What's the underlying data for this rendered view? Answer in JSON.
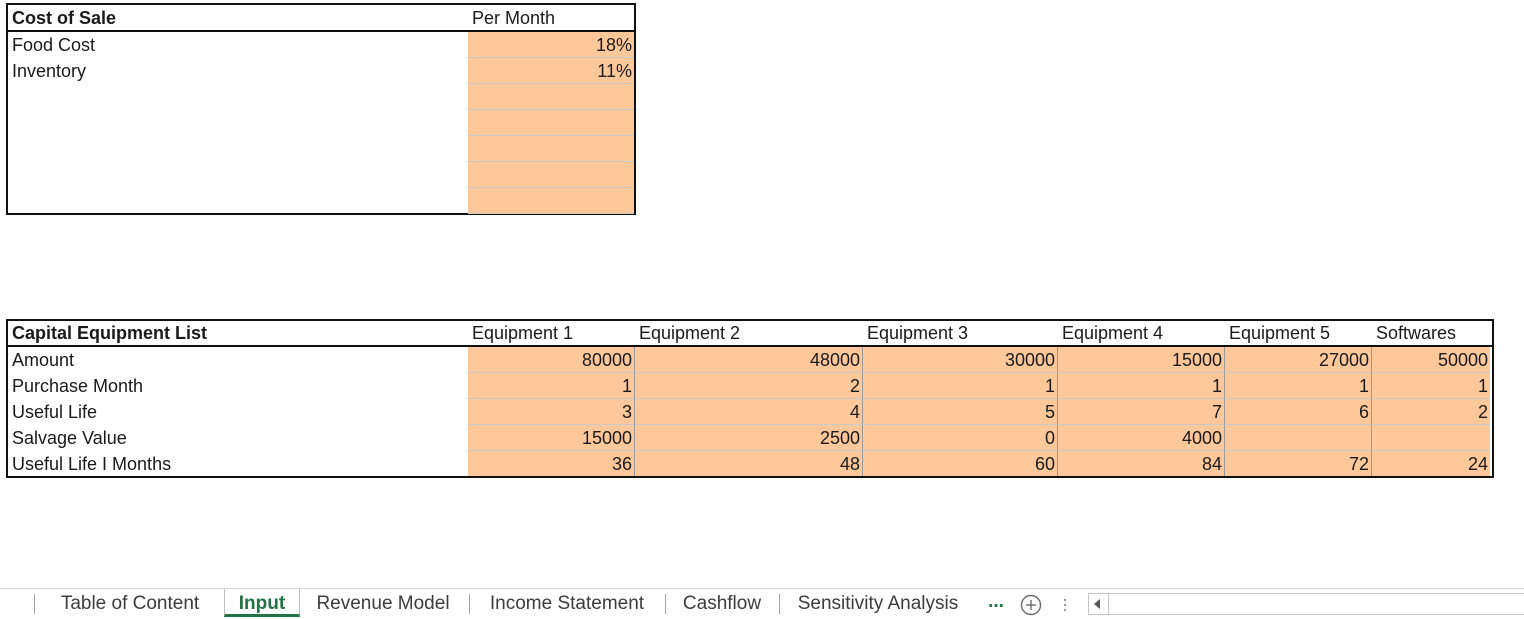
{
  "cost_of_sale": {
    "title": "Cost of Sale",
    "column_header": "Per Month",
    "rows": [
      {
        "label": "Food Cost",
        "value": "18%"
      },
      {
        "label": "Inventory",
        "value": "11%"
      },
      {
        "label": "",
        "value": ""
      },
      {
        "label": "",
        "value": ""
      },
      {
        "label": "",
        "value": ""
      },
      {
        "label": "",
        "value": ""
      },
      {
        "label": "",
        "value": ""
      }
    ],
    "input_fill_color": "#ffc89a"
  },
  "capital_equipment": {
    "title": "Capital Equipment List",
    "columns": [
      "Equipment 1",
      "Equipment 2",
      "Equipment 3",
      "Equipment 4",
      "Equipment 5",
      "Softwares"
    ],
    "rows": [
      {
        "label": "Amount",
        "values": [
          "80000",
          "48000",
          "30000",
          "15000",
          "27000",
          "50000"
        ]
      },
      {
        "label": "Purchase Month",
        "values": [
          "1",
          "2",
          "1",
          "1",
          "1",
          "1"
        ]
      },
      {
        "label": "Useful Life",
        "values": [
          "3",
          "4",
          "5",
          "7",
          "6",
          "2"
        ]
      },
      {
        "label": "Salvage Value",
        "values": [
          "15000",
          "2500",
          "0",
          "4000",
          "",
          ""
        ]
      },
      {
        "label": "Useful Life I Months",
        "values": [
          "36",
          "48",
          "60",
          "84",
          "72",
          "24"
        ]
      }
    ]
  },
  "sheet_tabs": {
    "tabs": [
      "Table of Content",
      "Input",
      "Revenue Model",
      "Income Statement",
      "Cashflow",
      "Sensitivity Analysis"
    ],
    "active": "Input",
    "more_label": "...",
    "active_color": "#217346"
  }
}
